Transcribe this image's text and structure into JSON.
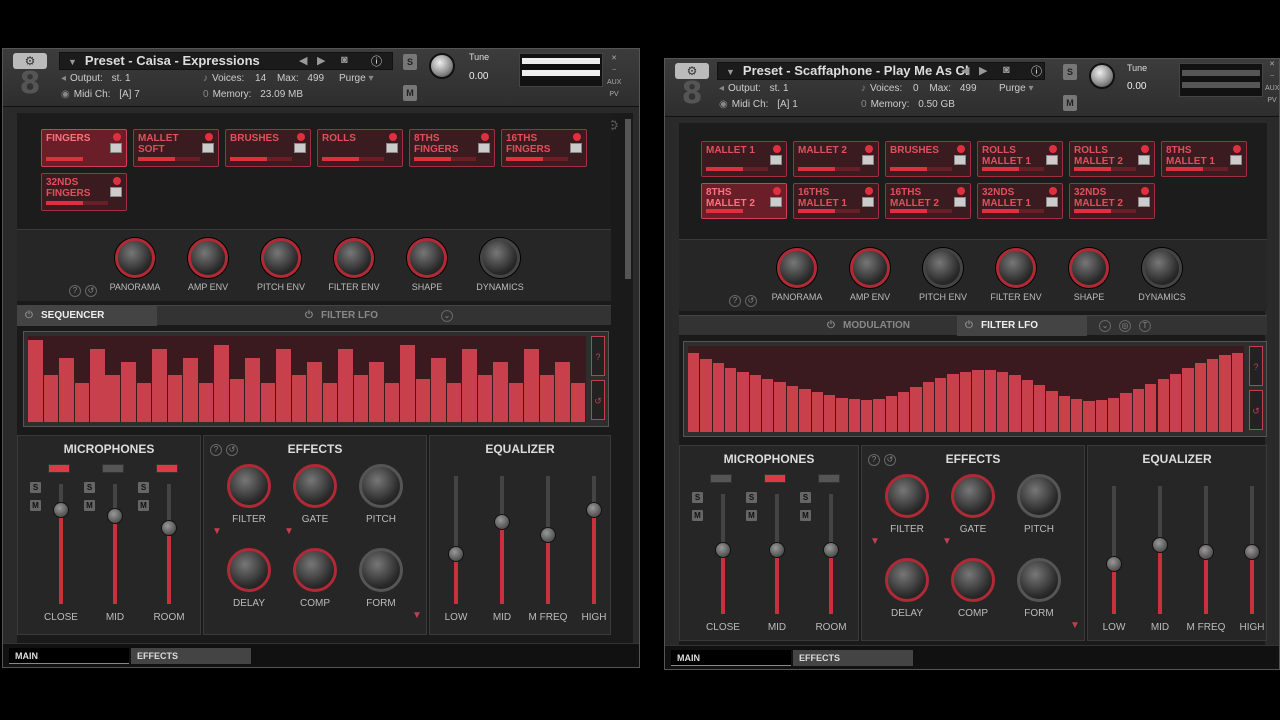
{
  "left": {
    "preset_title": "Preset - Caisa - Expressions",
    "output_label": "Output:",
    "output_value": "st. 1",
    "voices_label": "Voices:",
    "voices_value": "14",
    "max_label": "Max:",
    "max_value": "499",
    "purge_label": "Purge",
    "midi_label": "Midi Ch:",
    "midi_value": "[A]  7",
    "memory_label": "Memory:",
    "memory_value": "23.09 MB",
    "tune_label": "Tune",
    "tune_value": "0.00",
    "articulations": [
      {
        "line1": "FINGERS",
        "line2": "",
        "active": true,
        "level": 0.6
      },
      {
        "line1": "MALLET",
        "line2": "SOFT",
        "active": false,
        "level": 0.6
      },
      {
        "line1": "BRUSHES",
        "line2": "",
        "active": false,
        "level": 0.6
      },
      {
        "line1": "ROLLS",
        "line2": "",
        "active": false,
        "level": 0.6
      },
      {
        "line1": "8THS",
        "line2": "FINGERS",
        "active": false,
        "level": 0.6
      },
      {
        "line1": "16THS",
        "line2": "FINGERS",
        "active": false,
        "level": 0.6
      },
      {
        "line1": "32NDS",
        "line2": "FINGERS",
        "active": false,
        "level": 0.6
      }
    ],
    "knobs": [
      "PANORAMA",
      "AMP ENV",
      "PITCH ENV",
      "FILTER ENV",
      "SHAPE",
      "DYNAMICS"
    ],
    "tabs": [
      "SEQUENCER",
      "",
      "FILTER LFO"
    ],
    "sequencer_values": [
      0.95,
      0.55,
      0.75,
      0.45,
      0.85,
      0.55,
      0.7,
      0.45,
      0.85,
      0.55,
      0.75,
      0.45,
      0.9,
      0.5,
      0.75,
      0.45,
      0.85,
      0.55,
      0.7,
      0.45,
      0.85,
      0.55,
      0.7,
      0.45,
      0.9,
      0.5,
      0.75,
      0.45,
      0.85,
      0.55,
      0.7,
      0.45,
      0.85,
      0.55,
      0.7,
      0.45
    ],
    "mic_title": "MICROPHONES",
    "effects_title": "EFFECTS",
    "eq_title": "EQUALIZER",
    "mic_labels": [
      "CLOSE",
      "MID",
      "ROOM"
    ],
    "mic_levels": [
      0.85,
      0.8,
      0.7
    ],
    "effects_knobs": [
      "FILTER",
      "GATE",
      "PITCH",
      "DELAY",
      "COMP",
      "FORM"
    ],
    "eq_labels": [
      "LOW",
      "MID",
      "M FREQ",
      "HIGH"
    ],
    "eq_levels": [
      0.45,
      0.7,
      0.6,
      0.8
    ],
    "footer_main": "MAIN",
    "footer_effects": "EFFECTS"
  },
  "right": {
    "preset_title": "Preset - Scaffaphone - Play Me As Cl",
    "output_label": "Output:",
    "output_value": "st. 1",
    "voices_label": "Voices:",
    "voices_value": "0",
    "max_label": "Max:",
    "max_value": "499",
    "purge_label": "Purge",
    "midi_label": "Midi Ch:",
    "midi_value": "[A]  1",
    "memory_label": "Memory:",
    "memory_value": "0.50 GB",
    "tune_label": "Tune",
    "tune_value": "0.00",
    "articulations": [
      {
        "line1": "MALLET 1",
        "line2": "",
        "active": false,
        "level": 0.6
      },
      {
        "line1": "MALLET 2",
        "line2": "",
        "active": false,
        "level": 0.6
      },
      {
        "line1": "BRUSHES",
        "line2": "",
        "active": false,
        "level": 0.6
      },
      {
        "line1": "ROLLS",
        "line2": "MALLET 1",
        "active": false,
        "level": 0.6
      },
      {
        "line1": "ROLLS",
        "line2": "MALLET 2",
        "active": false,
        "level": 0.6
      },
      {
        "line1": "8THS",
        "line2": "MALLET 1",
        "active": false,
        "level": 0.6
      },
      {
        "line1": "8THS",
        "line2": "MALLET 2",
        "active": true,
        "level": 0.6
      },
      {
        "line1": "16THS",
        "line2": "MALLET 1",
        "active": false,
        "level": 0.6
      },
      {
        "line1": "16THS",
        "line2": "MALLET 2",
        "active": false,
        "level": 0.6
      },
      {
        "line1": "32NDS",
        "line2": "MALLET 1",
        "active": false,
        "level": 0.6
      },
      {
        "line1": "32NDS",
        "line2": "MALLET 2",
        "active": false,
        "level": 0.6
      }
    ],
    "knobs": [
      "PANORAMA",
      "AMP ENV",
      "PITCH ENV",
      "FILTER ENV",
      "SHAPE",
      "DYNAMICS"
    ],
    "tabs": [
      "",
      "MODULATION",
      "FILTER LFO"
    ],
    "lfo_values": [
      0.92,
      0.85,
      0.8,
      0.75,
      0.7,
      0.66,
      0.62,
      0.58,
      0.54,
      0.5,
      0.46,
      0.43,
      0.4,
      0.38,
      0.37,
      0.38,
      0.42,
      0.47,
      0.52,
      0.58,
      0.63,
      0.67,
      0.7,
      0.72,
      0.72,
      0.7,
      0.66,
      0.61,
      0.55,
      0.48,
      0.42,
      0.38,
      0.36,
      0.37,
      0.4,
      0.45,
      0.5,
      0.56,
      0.62,
      0.68,
      0.74,
      0.8,
      0.85,
      0.89,
      0.92
    ],
    "mic_title": "MICROPHONES",
    "effects_title": "EFFECTS",
    "eq_title": "EQUALIZER",
    "mic_labels": [
      "CLOSE",
      "MID",
      "ROOM"
    ],
    "mic_levels": [
      0.6,
      0.6,
      0.6
    ],
    "effects_knobs": [
      "FILTER",
      "GATE",
      "PITCH",
      "DELAY",
      "COMP",
      "FORM"
    ],
    "eq_labels": [
      "LOW",
      "MID",
      "M FREQ",
      "HIGH"
    ],
    "eq_levels": [
      0.45,
      0.6,
      0.55,
      0.55
    ],
    "footer_main": "MAIN",
    "footer_effects": "EFFECTS"
  },
  "colors": {
    "accent": "#e03040",
    "panel": "#2a2a2a",
    "bar": "#c8404c"
  }
}
